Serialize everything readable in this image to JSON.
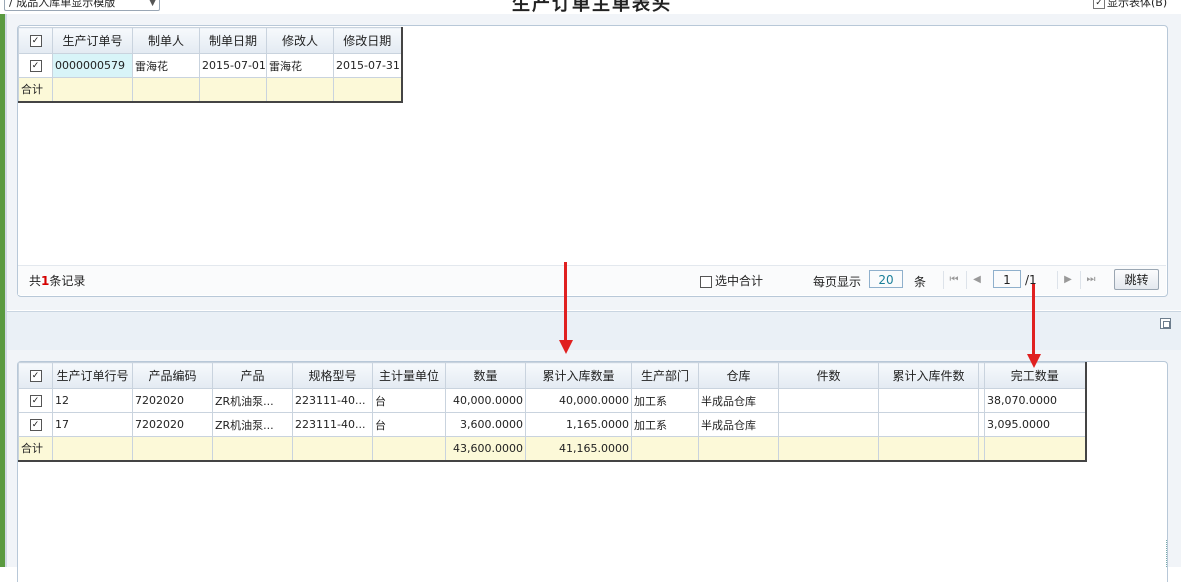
{
  "header": {
    "template_select": "/ 成品入库单显示模版",
    "title": "生产订单主单表头",
    "show_head_label": "显示表体(B)"
  },
  "top_grid": {
    "columns": [
      "生产订单号",
      "制单人",
      "制单日期",
      "修改人",
      "修改日期"
    ],
    "rows": [
      {
        "order_no": "0000000579",
        "maker": "雷海花",
        "make_date": "2015-07-01",
        "modifier": "雷海花",
        "modify_date": "2015-07-31"
      }
    ],
    "total_label": "合计"
  },
  "pager": {
    "count_prefix": "共",
    "count": "1",
    "count_suffix": "条记录",
    "selected_total": "选中合计",
    "per_page_label": "每页显示",
    "per_page_value": "20",
    "per_page_unit": "条",
    "current_page": "1",
    "total_pages": "/1",
    "jump_label": "跳转"
  },
  "bottom_grid": {
    "columns": [
      "生产订单行号",
      "产品编码",
      "产品",
      "规格型号",
      "主计量单位",
      "数量",
      "累计入库数量",
      "生产部门",
      "仓库",
      "件数",
      "累计入库件数",
      "",
      "完工数量"
    ],
    "rows": [
      {
        "line_no": "12",
        "code": "7202020",
        "product": "ZR机油泵...",
        "spec": "223111-40...",
        "unit": "台",
        "qty": "40,000.0000",
        "cum_in_qty": "40,000.0000",
        "dept": "加工系",
        "warehouse": "半成品仓库",
        "pieces": "",
        "cum_in_pieces": "",
        "blank": "",
        "finished_qty": "38,070.0000"
      },
      {
        "line_no": "17",
        "code": "7202020",
        "product": "ZR机油泵...",
        "spec": "223111-40...",
        "unit": "台",
        "qty": "3,600.0000",
        "cum_in_qty": "1,165.0000",
        "dept": "加工系",
        "warehouse": "半成品仓库",
        "pieces": "",
        "cum_in_pieces": "",
        "blank": "",
        "finished_qty": "3,095.0000"
      }
    ],
    "total": {
      "label": "合计",
      "qty": "43,600.0000",
      "cum_in_qty": "41,165.0000"
    }
  },
  "icons": {
    "checkbox_checked": "☑",
    "first_page": "⏮",
    "prev_page": "◀",
    "next_page": "▶",
    "last_page": "⏭"
  },
  "colors": {
    "annotation_arrow": "#e02020",
    "record_count": "#d40000",
    "total_row_bg": "#fcf9d8"
  }
}
